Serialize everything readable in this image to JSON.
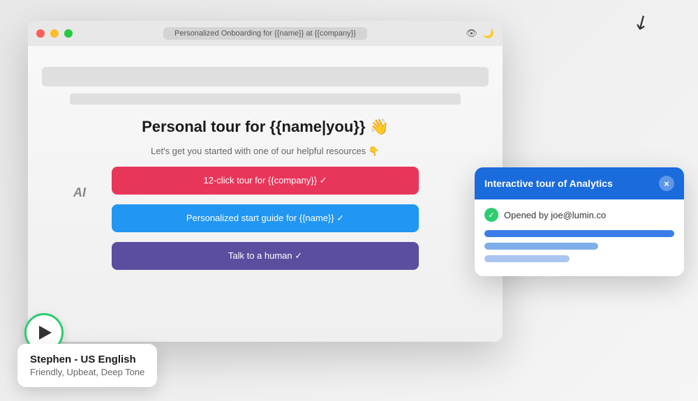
{
  "browser": {
    "url": "Personalized Onboarding for {{name}} at {{company}}",
    "title": "Browser Window"
  },
  "main": {
    "title": "Personal tour for {{name|you}} 👋",
    "subtitle": "Let's get you started with one of our helpful resources 👇",
    "buttons": [
      {
        "label": "12-click tour for {{company}} ✓",
        "style": "red"
      },
      {
        "label": "Personalized start guide for {{name}} ✓",
        "style": "blue"
      },
      {
        "label": "Talk to a human ✓",
        "style": "purple"
      }
    ],
    "ai_label": "AI"
  },
  "voice_card": {
    "name": "Stephen - US English",
    "description": "Friendly, Upbeat, Deep Tone"
  },
  "notification": {
    "title": "Interactive tour of Analytics",
    "close_label": "×",
    "user_text": "Opened by joe@lumin.co",
    "progress_bars": [
      {
        "width": "full"
      },
      {
        "width": "mid"
      },
      {
        "width": "short"
      }
    ]
  },
  "icons": {
    "eye": "👁",
    "moon": "🌙",
    "play": "▶",
    "check": "✓",
    "close": "×"
  }
}
